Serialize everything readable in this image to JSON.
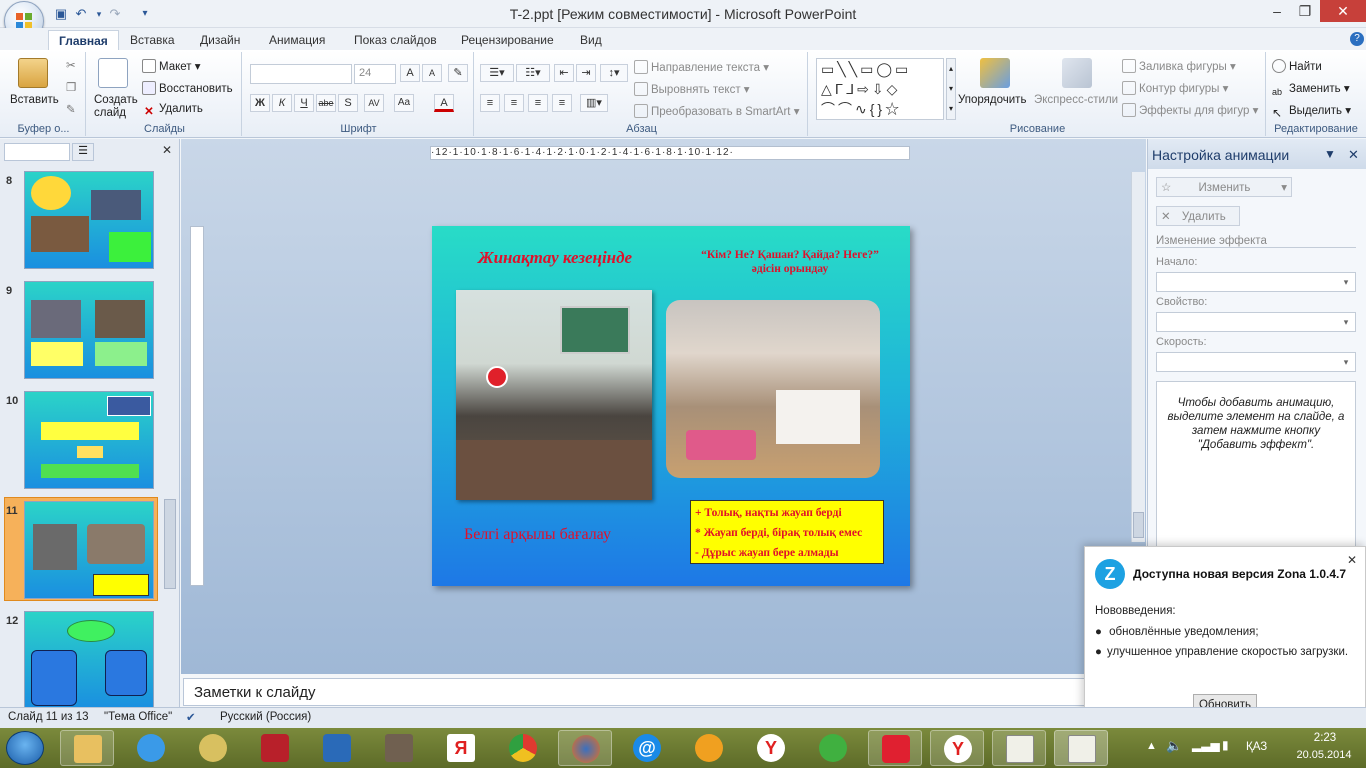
{
  "window": {
    "title": "T-2.ppt [Режим совместимости] - Microsoft PowerPoint"
  },
  "tabs": [
    "Главная",
    "Вставка",
    "Дизайн",
    "Анимация",
    "Показ слайдов",
    "Рецензирование",
    "Вид"
  ],
  "ribbon": {
    "clipboard": {
      "label": "Буфер о...",
      "paste": "Вставить"
    },
    "slides": {
      "label": "Слайды",
      "new_slide": "Создать слайд",
      "layout": "Макет",
      "reset": "Восстановить",
      "delete": "Удалить"
    },
    "font": {
      "label": "Шрифт",
      "size": "24",
      "bold": "Ж",
      "italic": "К",
      "underline": "Ч",
      "strike": "abe",
      "shadow": "S",
      "spacing": "AV",
      "case": "Aa",
      "color": "A",
      "grow": "A",
      "shrink": "A"
    },
    "paragraph": {
      "label": "Абзац",
      "text_direction": "Направление текста",
      "align_text": "Выровнять текст",
      "smartart": "Преобразовать в SmartArt"
    },
    "drawing": {
      "label": "Рисование",
      "arrange": "Упорядочить",
      "quick_styles": "Экспресс-стили",
      "fill": "Заливка фигуры",
      "outline": "Контур фигуры",
      "effects": "Эффекты для фигур"
    },
    "editing": {
      "label": "Редактирование",
      "find": "Найти",
      "replace": "Заменить",
      "select": "Выделить"
    }
  },
  "slide_pane": {
    "slides": [
      "8",
      "9",
      "10",
      "11",
      "12"
    ],
    "selected": "11"
  },
  "slide": {
    "title_left": "Жинақтау кезеңінде",
    "title_right_line1": "“Кім? Не? Қашан? Қайда? Неге?”",
    "title_right_line2": "әдісін орындау",
    "caption": "Белгі арқылы бағалау",
    "legend": [
      "+ Толық, нақты жауап берді",
      "* Жауап берді, бірақ толық емес",
      "- Дұрыс жауап бере алмады"
    ]
  },
  "ruler": {
    "ticks": "·12·1·10·1·8·1·6·1·4·1·2·1·0·1·2·1·4·1·6·1·8·1·10·1·12·"
  },
  "notes": {
    "placeholder": "Заметки к слайду"
  },
  "animation_pane": {
    "title": "Настройка анимации",
    "change_button": "Изменить",
    "delete_button": "Удалить",
    "section": "Изменение эффекта",
    "start_label": "Начало:",
    "property_label": "Свойство:",
    "speed_label": "Скорость:",
    "hint": "Чтобы добавить анимацию, выделите элемент на слайде, а затем нажмите кнопку \"Добавить эффект\"."
  },
  "popup": {
    "title": "Доступна новая версия Zona 1.0.4.7",
    "subtitle": "Нововведения:",
    "items": [
      "обновлённые уведомления;",
      "улучшенное управление скоростью загрузки."
    ],
    "button": "Обновить"
  },
  "status": {
    "slide": "Слайд 11 из 13",
    "theme": "\"Тема Office\"",
    "language": "Русский (Россия)"
  },
  "taskbar": {
    "time": "2:23",
    "date": "20.05.2014",
    "lang": "ҚАЗ"
  },
  "colors": {
    "accent": "#2b5797",
    "slide_top": "#28dcc7",
    "slide_bottom": "#1e78e6",
    "caption_red": "#e0102a",
    "legend_bg": "#ffff00"
  }
}
